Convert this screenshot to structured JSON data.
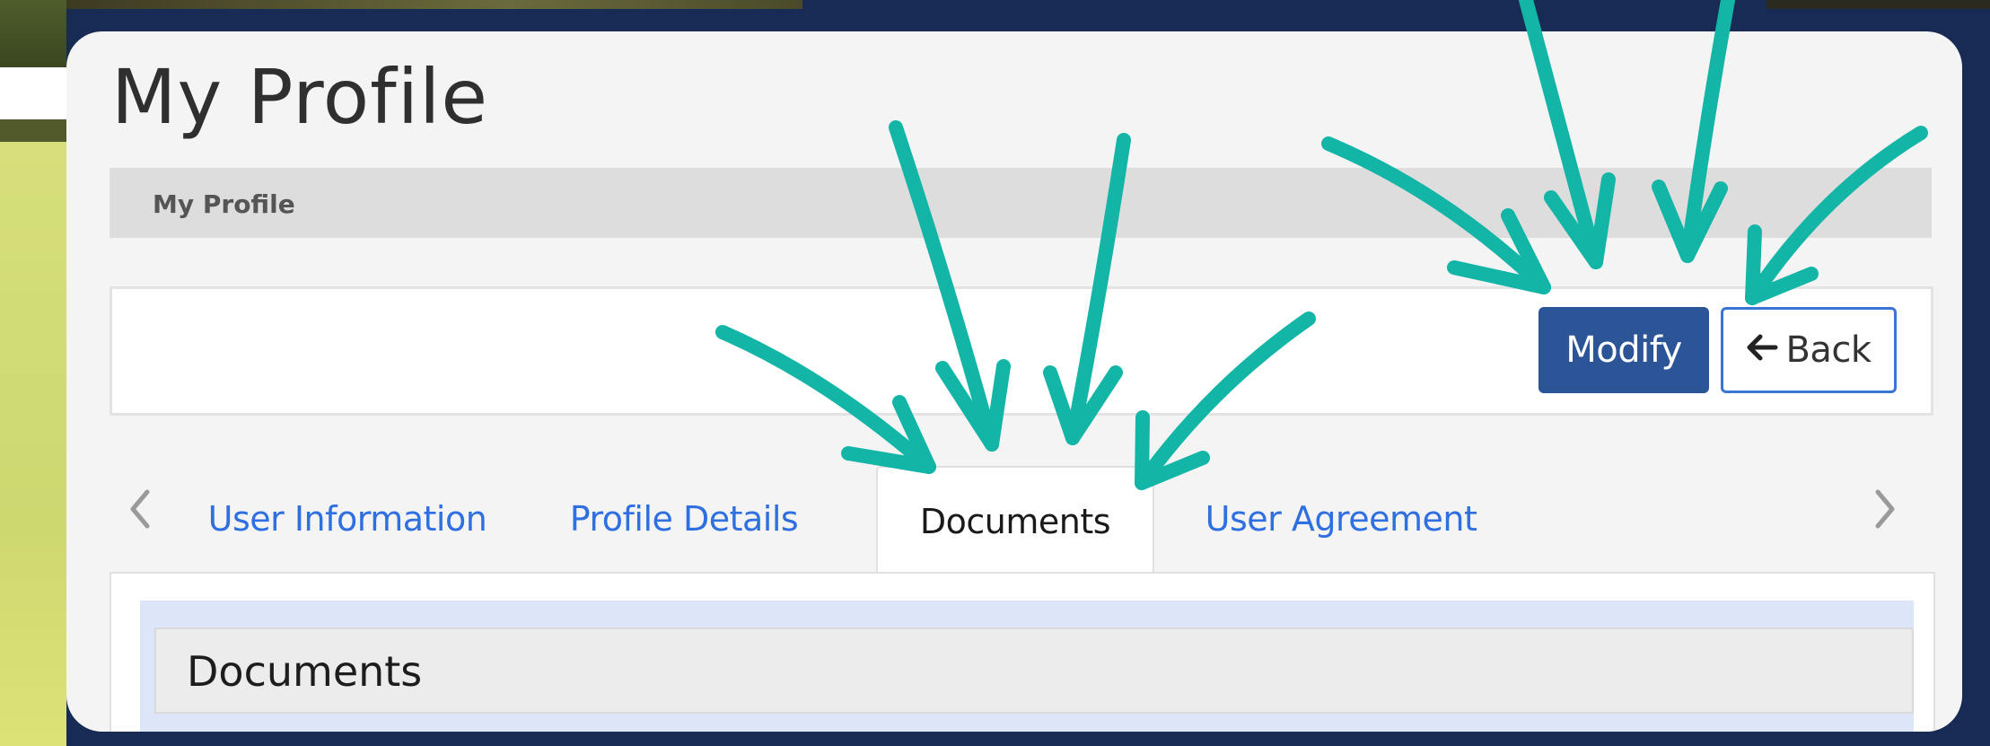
{
  "page": {
    "title": "My Profile"
  },
  "breadcrumb": {
    "items": [
      "My Profile"
    ]
  },
  "toolbar": {
    "modify_label": "Modify",
    "back_label": "Back",
    "back_icon": "arrow-left-icon"
  },
  "tabs": {
    "prev_icon": "chevron-left-icon",
    "next_icon": "chevron-right-icon",
    "items": [
      {
        "label": "User Information",
        "active": false
      },
      {
        "label": "Profile Details",
        "active": false
      },
      {
        "label": "Documents",
        "active": true
      },
      {
        "label": "User Agreement",
        "active": false
      }
    ]
  },
  "documents_panel": {
    "title": "Documents"
  },
  "annotations": {
    "color": "#12b5a6",
    "description_icon": "hand-drawn-arrow-icon",
    "targets": [
      "Documents tab",
      "Modify button",
      "Back button"
    ]
  },
  "colors": {
    "frame_background": "#172b54",
    "primary_button": "#2c5597",
    "link_tab": "#2f6fe0",
    "panel_tint": "#dce6f8"
  }
}
